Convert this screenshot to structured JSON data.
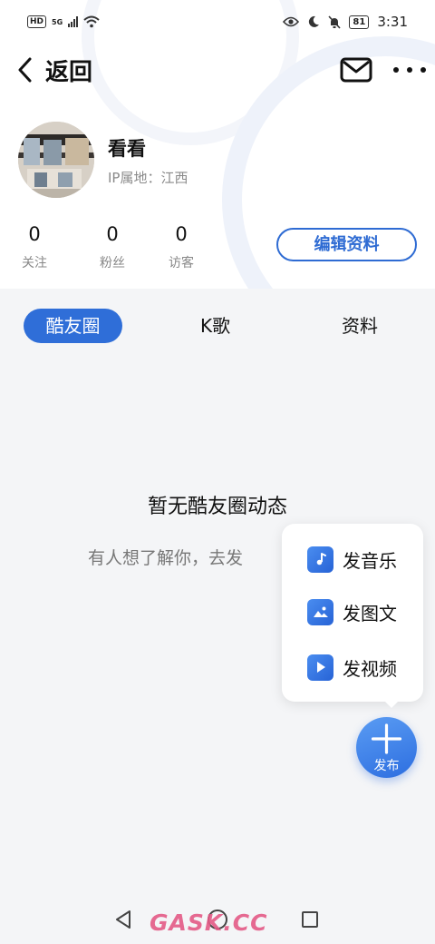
{
  "status_bar": {
    "hd": "HD",
    "signal": "5G",
    "battery": "81",
    "time": "3:31"
  },
  "header": {
    "back_label": "返回"
  },
  "profile": {
    "name": "看看",
    "ip_location": "IP属地：江西",
    "stats": [
      {
        "value": "0",
        "label": "关注"
      },
      {
        "value": "0",
        "label": "粉丝"
      },
      {
        "value": "0",
        "label": "访客"
      }
    ],
    "edit_label": "编辑资料"
  },
  "tabs": [
    {
      "label": "酷友圈",
      "active": true
    },
    {
      "label": "K歌",
      "active": false
    },
    {
      "label": "资料",
      "active": false
    }
  ],
  "empty_state": {
    "title": "暂无酷友圈动态",
    "subtitle": "有人想了解你，去发"
  },
  "publish_menu": {
    "items": [
      {
        "label": "发音乐",
        "icon": "music-note-icon"
      },
      {
        "label": "发图文",
        "icon": "image-icon"
      },
      {
        "label": "发视频",
        "icon": "play-icon"
      }
    ]
  },
  "fab": {
    "label": "发布"
  },
  "watermark": "GASK.CC",
  "colors": {
    "accent": "#2f6ed8",
    "background": "#f4f5f7"
  }
}
